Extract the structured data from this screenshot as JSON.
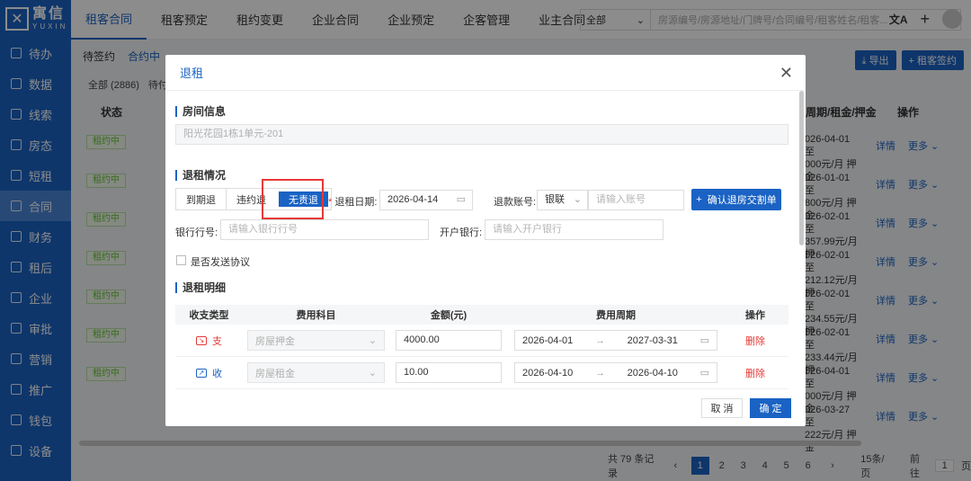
{
  "sidebar": {
    "logo_cn": "寓信",
    "logo_en": "YUXIN",
    "items": [
      {
        "label": "待办",
        "icon": "calendar-icon"
      },
      {
        "label": "数据",
        "icon": "chart-icon"
      },
      {
        "label": "线索",
        "icon": "clue-icon"
      },
      {
        "label": "房态",
        "icon": "home-icon"
      },
      {
        "label": "短租",
        "icon": "short-rent-icon"
      },
      {
        "label": "合同",
        "icon": "contract-icon"
      },
      {
        "label": "财务",
        "icon": "finance-icon"
      },
      {
        "label": "租后",
        "icon": "after-rent-icon"
      },
      {
        "label": "企业",
        "icon": "enterprise-icon"
      },
      {
        "label": "审批",
        "icon": "approval-icon"
      },
      {
        "label": "营销",
        "icon": "marketing-icon"
      },
      {
        "label": "推广",
        "icon": "promote-icon"
      },
      {
        "label": "钱包",
        "icon": "wallet-icon"
      },
      {
        "label": "设备",
        "icon": "device-icon"
      }
    ],
    "active_index": 5
  },
  "topbar": {
    "tabs": [
      "租客合同",
      "租客预定",
      "租约变更",
      "企业合同",
      "企业预定",
      "企客管理",
      "业主合同"
    ],
    "active_tab": 0,
    "search_select": "全部",
    "search_placeholder": "房源编号/房源地址/门牌号/合同编号/租客姓名/租客..."
  },
  "background": {
    "subtabs": [
      "待签约",
      "合约中"
    ],
    "filter_all": "全部 (2886)",
    "filter_pending": "待付",
    "export_label": "导出",
    "sign_label": "租客签约",
    "col_status": "状态",
    "col_period": "周期/租金/押金",
    "col_ops": "操作",
    "status_tag": "租约中",
    "rows_right": [
      [
        "026-04-01 至",
        "000元/月 押金"
      ],
      [
        "026-01-01 至",
        "800元/月 押金"
      ],
      [
        "026-02-01 至",
        "357.99元/月 押"
      ],
      [
        "026-02-01 至",
        "212.12元/月 押"
      ],
      [
        "026-02-01 至",
        "234.55元/月 押"
      ],
      [
        "026-02-01 至",
        "233.44元/月 押"
      ],
      [
        "026-04-01 至",
        "000元/月 押金"
      ],
      [
        "026-03-27 至",
        "222元/月 押金"
      ]
    ],
    "op_detail": "详情",
    "op_more": "更多",
    "pager_total": "共 79 条记录",
    "pages": [
      "1",
      "2",
      "3",
      "4",
      "5",
      "6"
    ],
    "page_size": "15条/页",
    "goto_label": "前往",
    "goto_value": "1",
    "page_unit": "页"
  },
  "modal": {
    "title": "退租",
    "section_room": "房间信息",
    "room_value": "阳光花园1栋1单元-201",
    "section_checkout": "退租情况",
    "types": [
      "到期退",
      "违约退",
      "无责退"
    ],
    "active_type": 2,
    "date_label": "退租日期:",
    "date_value": "2026-04-14",
    "account_label": "退款账号:",
    "account_type": "银联",
    "account_placeholder": "请输入账号",
    "confirm_bill": "确认退房交割单",
    "bank_no_label": "银行行号:",
    "bank_no_placeholder": "请输入银行行号",
    "bank_label": "开户银行:",
    "bank_placeholder": "请输入开户银行",
    "send_agreement": "是否发送协议",
    "section_detail": "退租明细",
    "columns": [
      "收支类型",
      "费用科目",
      "金额(元)",
      "费用周期",
      "操作"
    ],
    "rows": [
      {
        "io": "支",
        "io_color": "#e53935",
        "subject": "房屋押金",
        "amount": "4000.00",
        "start": "2026-04-01",
        "end": "2027-03-31",
        "action": "删除"
      },
      {
        "io": "收",
        "io_color": "#1a63c4",
        "subject": "房屋租金",
        "amount": "10.00",
        "start": "2026-04-10",
        "end": "2026-04-10",
        "action": "删除"
      }
    ],
    "cancel": "取 消",
    "ok": "确 定"
  },
  "colors": {
    "primary": "#1a63c4",
    "danger": "#e53935",
    "success": "#67c23a"
  }
}
